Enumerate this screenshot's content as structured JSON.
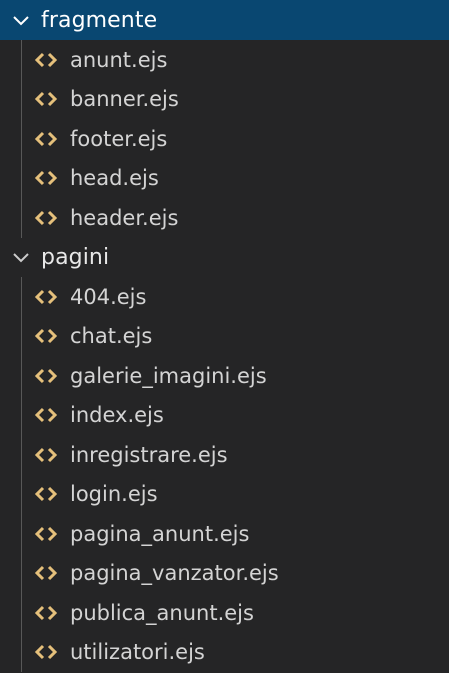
{
  "explorer": {
    "folders": [
      {
        "name": "fragmente",
        "icon": "chevron-down-icon",
        "expanded": true,
        "selected": true,
        "files": [
          "anunt.ejs",
          "banner.ejs",
          "footer.ejs",
          "head.ejs",
          "header.ejs"
        ]
      },
      {
        "name": "pagini",
        "icon": "chevron-down-icon",
        "expanded": true,
        "selected": false,
        "files": [
          "404.ejs",
          "chat.ejs",
          "galerie_imagini.ejs",
          "index.ejs",
          "inregistrare.ejs",
          "login.ejs",
          "pagina_anunt.ejs",
          "pagina_vanzator.ejs",
          "publica_anunt.ejs",
          "utilizatori.ejs"
        ]
      }
    ],
    "file_icon": "ejs-file-icon",
    "colors": {
      "background": "#252526",
      "selection": "#094771",
      "file_icon": "#e5c07b",
      "text": "#d4d4d4"
    }
  }
}
